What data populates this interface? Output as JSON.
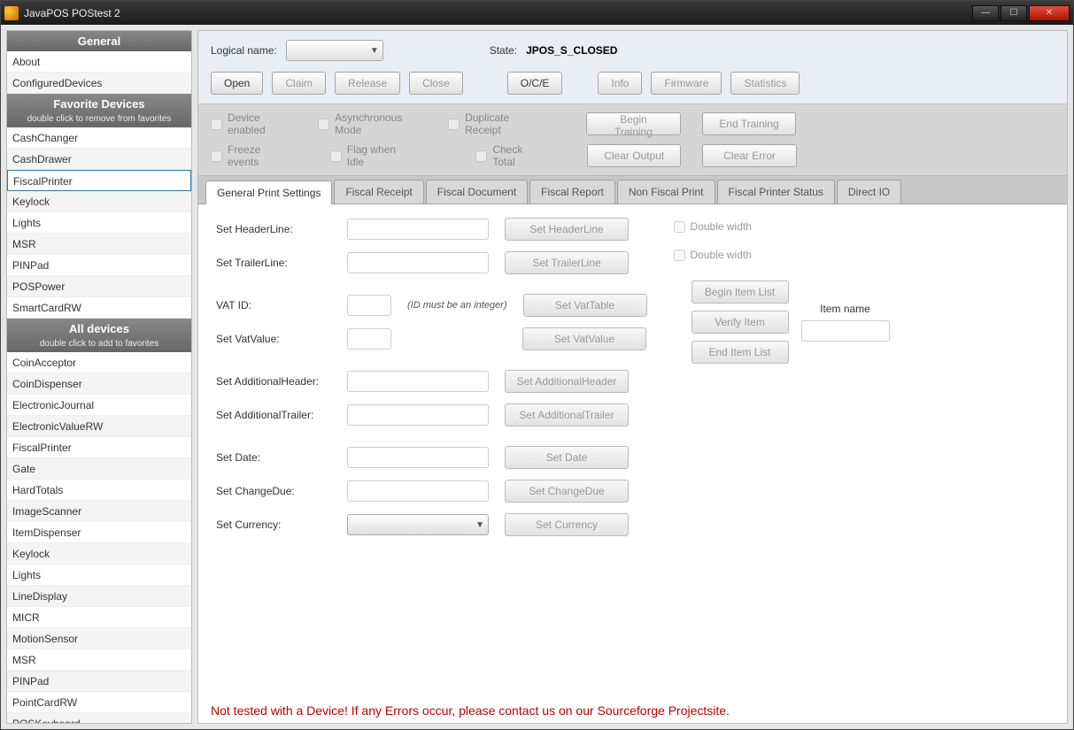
{
  "window": {
    "title": "JavaPOS POStest 2"
  },
  "sidebar": {
    "general": {
      "title": "General",
      "items": [
        "About",
        "ConfiguredDevices"
      ]
    },
    "favorites": {
      "title": "Favorite Devices",
      "sub": "double click to remove from favorites",
      "items": [
        "CashChanger",
        "CashDrawer",
        "FiscalPrinter",
        "Keylock",
        "Lights",
        "MSR",
        "PINPad",
        "POSPower",
        "SmartCardRW"
      ],
      "selected": "FiscalPrinter"
    },
    "all": {
      "title": "All devices",
      "sub": "double click to add to favorites",
      "items": [
        "CoinAcceptor",
        "CoinDispenser",
        "ElectronicJournal",
        "ElectronicValueRW",
        "FiscalPrinter",
        "Gate",
        "HardTotals",
        "ImageScanner",
        "ItemDispenser",
        "Keylock",
        "Lights",
        "LineDisplay",
        "MICR",
        "MotionSensor",
        "MSR",
        "PINPad",
        "PointCardRW",
        "POSKeyboard"
      ]
    }
  },
  "top": {
    "logical_name_label": "Logical name:",
    "state_label": "State:",
    "state_value": "JPOS_S_CLOSED",
    "buttons": {
      "open": "Open",
      "claim": "Claim",
      "release": "Release",
      "close": "Close",
      "oce": "O/C/E",
      "info": "Info",
      "firmware": "Firmware",
      "statistics": "Statistics"
    }
  },
  "controls": {
    "chk": {
      "device_enabled": "Device enabled",
      "async": "Asynchronous Mode",
      "dup": "Duplicate Receipt",
      "freeze": "Freeze events",
      "flag": "Flag when Idle",
      "check_total": "Check Total"
    },
    "btns": {
      "begin_training": "Begin Training",
      "end_training": "End Training",
      "clear_output": "Clear Output",
      "clear_error": "Clear Error"
    }
  },
  "tabs": [
    "General Print Settings",
    "Fiscal Receipt",
    "Fiscal Document",
    "Fiscal Report",
    "Non Fiscal Print",
    "Fiscal Printer Status",
    "Direct IO"
  ],
  "form": {
    "set_header": "Set HeaderLine:",
    "btn_header": "Set HeaderLine",
    "dw": "Double width",
    "set_trailer": "Set TrailerLine:",
    "btn_trailer": "Set TrailerLine",
    "vat_id": "VAT ID:",
    "vat_hint": "(ID must be an integer)",
    "btn_vattable": "Set VatTable",
    "set_vatvalue": "Set VatValue:",
    "btn_vatvalue": "Set VatValue",
    "begin_item": "Begin Item List",
    "verify_item": "Verify Item",
    "end_item": "End Item List",
    "item_name": "Item name",
    "set_addheader": "Set AdditionalHeader:",
    "btn_addheader": "Set AdditionalHeader",
    "set_addtrailer": "Set AdditionalTrailer:",
    "btn_addtrailer": "Set AdditionalTrailer",
    "set_date": "Set Date:",
    "btn_date": "Set Date",
    "set_changedue": "Set ChangeDue:",
    "btn_changedue": "Set ChangeDue",
    "set_currency": "Set Currency:",
    "btn_currency": "Set Currency"
  },
  "footer": "Not tested with a Device! If any Errors occur, please contact us on our Sourceforge Projectsite."
}
